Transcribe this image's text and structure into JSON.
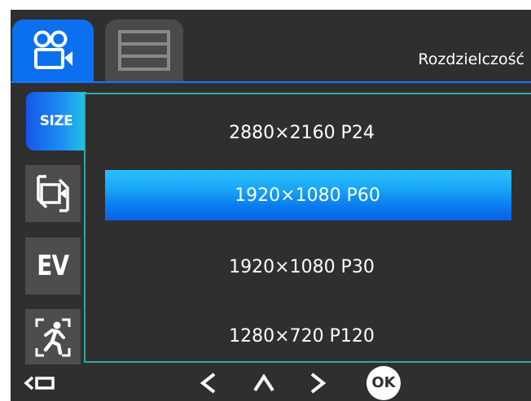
{
  "header": {
    "title": "Rozdzielczość",
    "tabs": [
      {
        "icon": "video-camera-icon",
        "active": true
      },
      {
        "icon": "menu-list-icon",
        "active": false
      }
    ]
  },
  "sidebar": {
    "items": [
      {
        "label": "SIZE",
        "active": true
      },
      {
        "icon": "video-loop-icon",
        "active": false
      },
      {
        "label": "EV",
        "active": false
      },
      {
        "icon": "motion-detect-icon",
        "active": false
      }
    ]
  },
  "options": [
    {
      "label": "2880×2160 P24",
      "selected": false
    },
    {
      "label": "1920×1080 P60",
      "selected": true
    },
    {
      "label": "1920×1080 P30",
      "selected": false
    },
    {
      "label": "1280×720 P120",
      "selected": false
    }
  ],
  "footer": {
    "buttons": [
      {
        "icon": "back-icon"
      },
      {
        "icon": "left-arrow-icon"
      },
      {
        "icon": "up-arrow-icon"
      },
      {
        "icon": "right-arrow-icon"
      },
      {
        "label": "OK"
      }
    ]
  },
  "colors": {
    "accent_blue": "#0a70f0",
    "panel_border": "#2ea9a6",
    "background": "#2f2f2f"
  }
}
